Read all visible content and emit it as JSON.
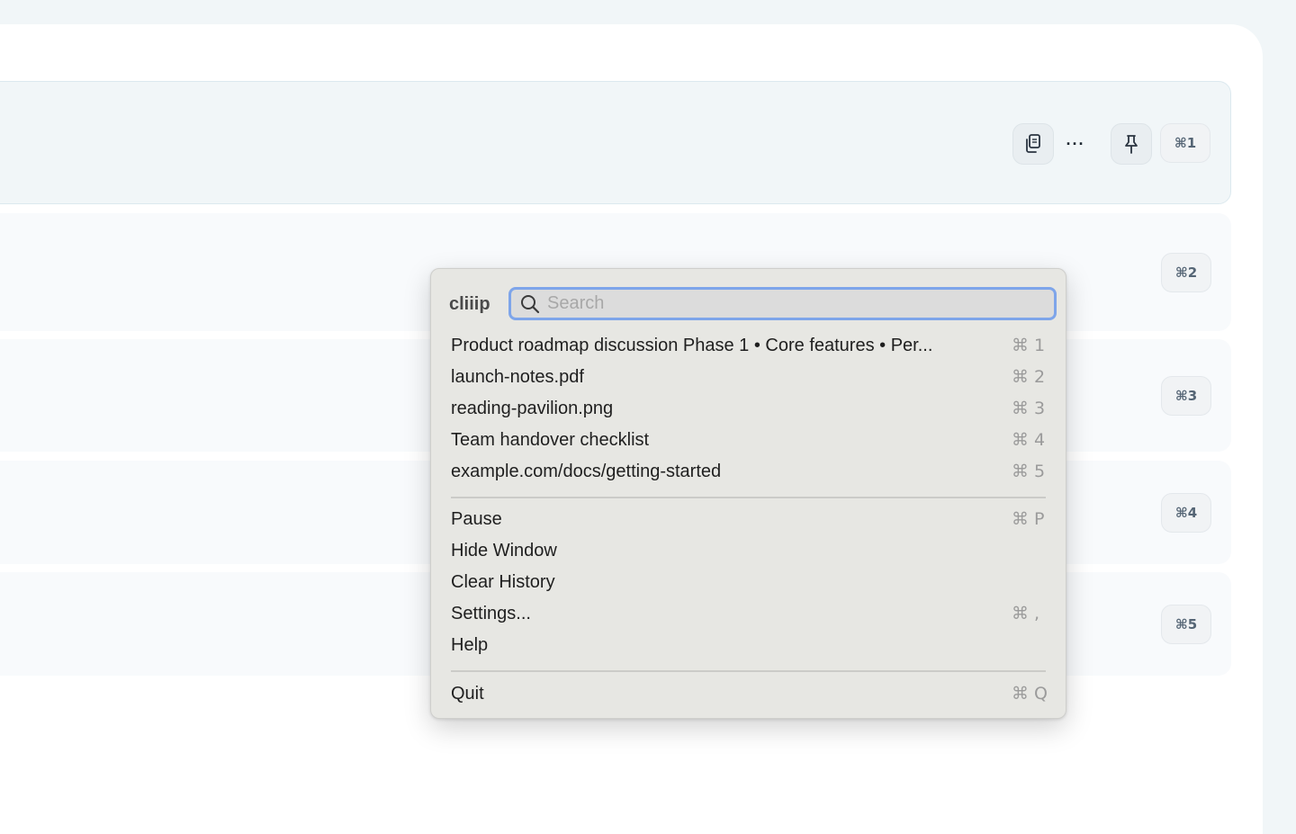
{
  "background_rows": {
    "badges": [
      "⌘1",
      "⌘2",
      "⌘3",
      "⌘4",
      "⌘5"
    ],
    "actions": {
      "copy_icon": "copy-icon",
      "more_label": "···",
      "pin_icon": "pin-icon"
    }
  },
  "menu": {
    "app_name": "cliiip",
    "search": {
      "placeholder": "Search",
      "value": ""
    },
    "clips": [
      {
        "label": "Product roadmap discussion  Phase 1 • Core features • Per...",
        "key": "⌘ 1"
      },
      {
        "label": "launch-notes.pdf",
        "key": "⌘ 2"
      },
      {
        "label": "reading-pavilion.png",
        "key": "⌘ 3"
      },
      {
        "label": "Team handover checklist",
        "key": "⌘ 4"
      },
      {
        "label": "example.com/docs/getting-started",
        "key": "⌘ 5"
      }
    ],
    "actions": [
      {
        "label": "Pause",
        "key": "⌘ P"
      },
      {
        "label": "Hide Window",
        "key": ""
      },
      {
        "label": "Clear History",
        "key": ""
      },
      {
        "label": "Settings...",
        "key": "⌘ ,"
      },
      {
        "label": "Help",
        "key": ""
      }
    ],
    "quit": {
      "label": "Quit",
      "key": "⌘ Q"
    }
  },
  "colors": {
    "page_bg": "#f1f6f8",
    "panel_bg": "#ffffff",
    "menu_bg": "#e7e7e3",
    "search_focus_ring": "#7ea5ea"
  }
}
